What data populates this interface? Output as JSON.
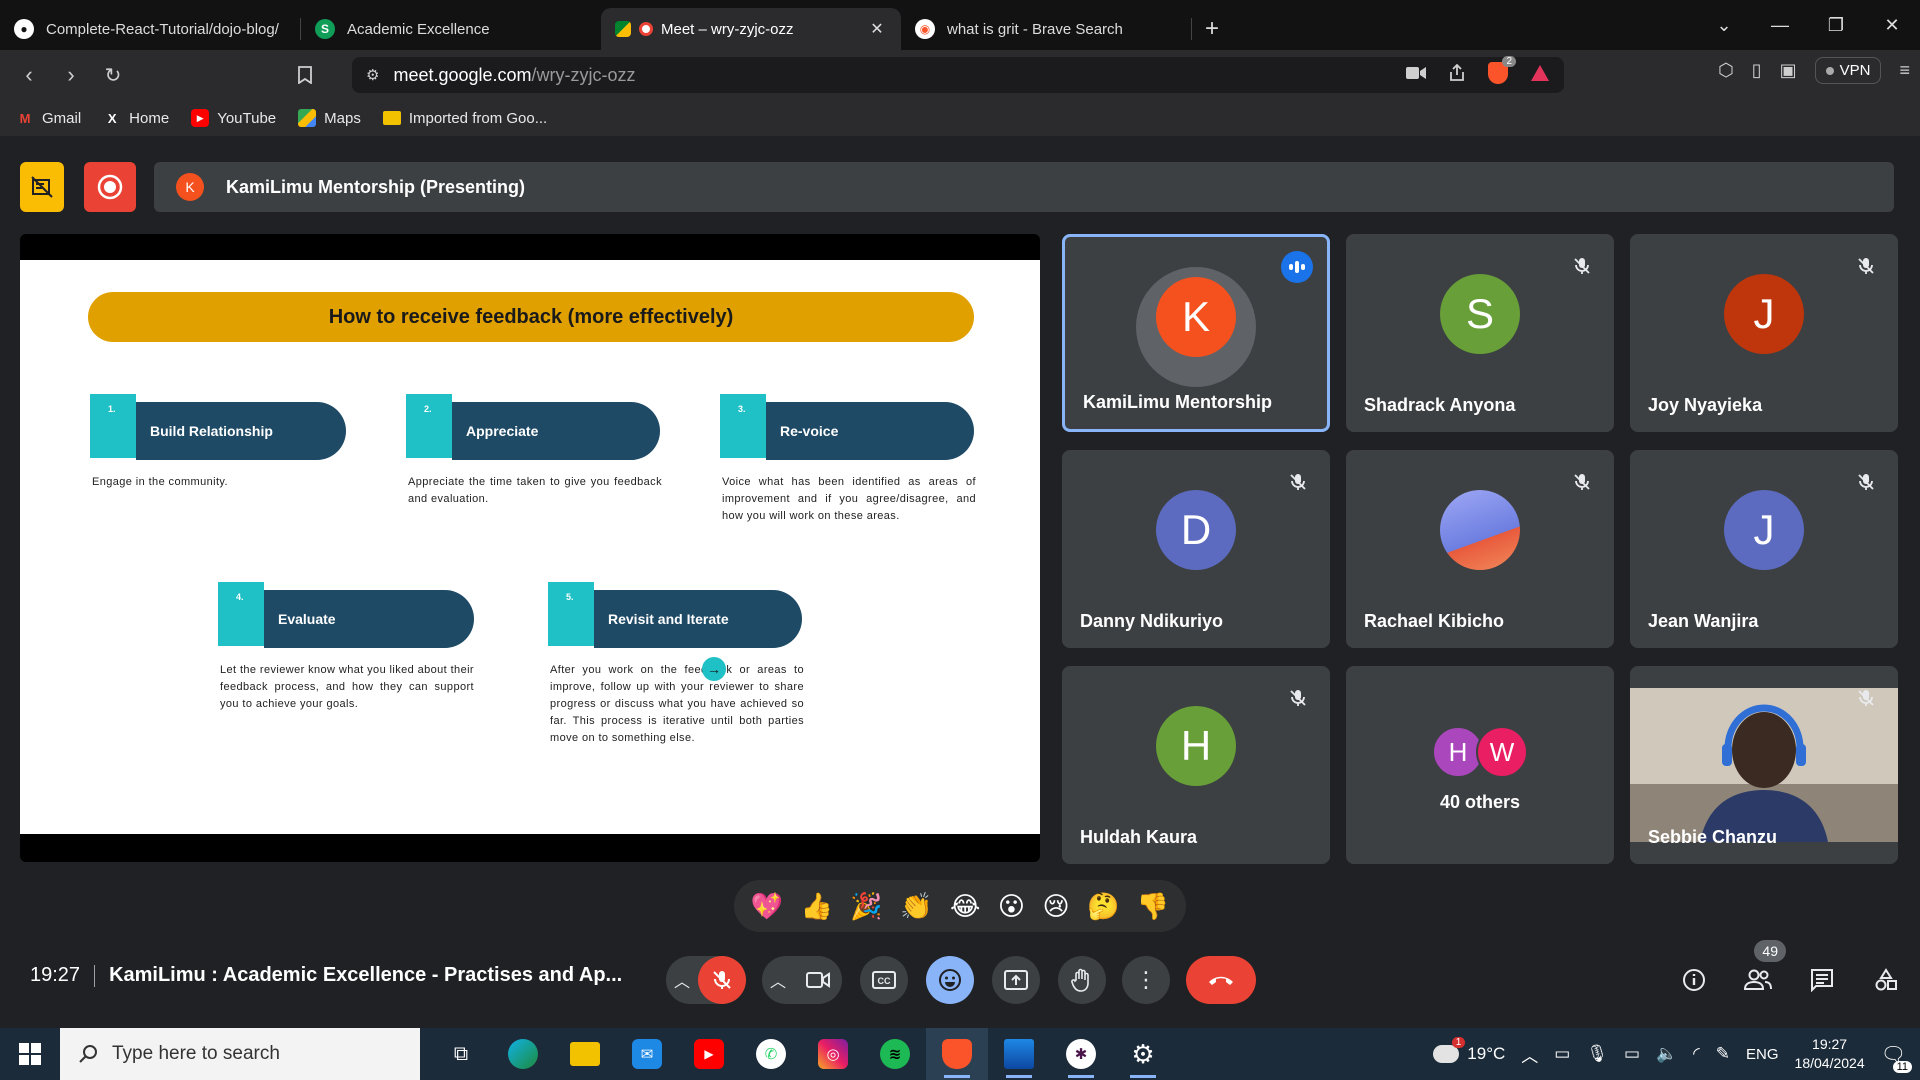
{
  "browser": {
    "tabs": [
      {
        "title": "Complete-React-Tutorial/dojo-blog/",
        "icon": "github-icon",
        "active": false
      },
      {
        "title": "Academic Excellence",
        "icon": "spreadsheet-icon",
        "active": false
      },
      {
        "title": "Meet – wry-zyjc-ozz",
        "icon": "meet-icon",
        "active": true
      },
      {
        "title": "what is grit - Brave Search",
        "icon": "brave-search-icon",
        "active": false
      }
    ],
    "url_host": "meet.google.com",
    "url_path": "/wry-zyjc-ozz",
    "shields_badge": "2",
    "vpn_label": "VPN",
    "bookmarks": [
      {
        "label": "Gmail",
        "icon": "gmail-icon"
      },
      {
        "label": "Home",
        "icon": "x-icon"
      },
      {
        "label": "YouTube",
        "icon": "youtube-icon"
      },
      {
        "label": "Maps",
        "icon": "maps-icon"
      },
      {
        "label": "Imported from Goo...",
        "icon": "folder-icon"
      }
    ]
  },
  "meet": {
    "presenting_banner": "KamiLimu Mentorship (Presenting)",
    "presenter_initial": "K",
    "slide": {
      "title": "How to receive feedback (more effectively)",
      "steps": [
        {
          "num": "1.",
          "title": "Build Relationship",
          "desc": "Engage in the community."
        },
        {
          "num": "2.",
          "title": "Appreciate",
          "desc": "Appreciate the time taken to give you feedback and evaluation."
        },
        {
          "num": "3.",
          "title": "Re-voice",
          "desc": "Voice what has been identified as areas of improvement and if you agree/disagree, and how you will work on these areas."
        },
        {
          "num": "4.",
          "title": "Evaluate",
          "desc": "Let the reviewer know what you liked about their feedback process, and how they can support you to achieve your goals."
        },
        {
          "num": "5.",
          "title": "Revisit and Iterate",
          "desc": "After you work on the feedback or areas to improve, follow up with your reviewer to share progress or discuss what you have achieved so far. This process is iterative until both parties move on to something else."
        }
      ]
    },
    "participants": [
      {
        "name": "KamiLimu Mentorship",
        "initial": "K",
        "color": "#f4511e",
        "speaking": true
      },
      {
        "name": "Shadrack Anyona",
        "initial": "S",
        "color": "#689f38",
        "muted": true
      },
      {
        "name": "Joy Nyayieka",
        "initial": "J",
        "color": "#bf360c",
        "muted": true
      },
      {
        "name": "Danny Ndikuriyo",
        "initial": "D",
        "color": "#5c6bc0",
        "muted": true
      },
      {
        "name": "Rachael Kibicho",
        "initial": "",
        "color": "#7b8cde",
        "muted": true
      },
      {
        "name": "Jean Wanjira",
        "initial": "J",
        "color": "#5c6bc0",
        "muted": true
      },
      {
        "name": "Huldah Kaura",
        "initial": "H",
        "color": "#689f38",
        "muted": true
      },
      {
        "name": "Sebbie Chanzu",
        "initial": "",
        "color": "#3c4043",
        "muted": true
      }
    ],
    "others": {
      "label": "40 others",
      "initials": [
        "H",
        "W"
      ],
      "colors": [
        "#ab47bc",
        "#e91e63"
      ]
    },
    "reactions": [
      "💖",
      "👍",
      "🎉",
      "👏",
      "😂",
      "😮",
      "😢",
      "🤔",
      "👎"
    ],
    "time": "19:27",
    "meeting_title": "KamiLimu : Academic Excellence - Practises and Ap...",
    "people_count": "49"
  },
  "taskbar": {
    "search_placeholder": "Type here to search",
    "weather": "19°C",
    "weather_badge": "1",
    "language": "ENG",
    "time": "19:27",
    "date": "18/04/2024",
    "notifications": "11"
  }
}
